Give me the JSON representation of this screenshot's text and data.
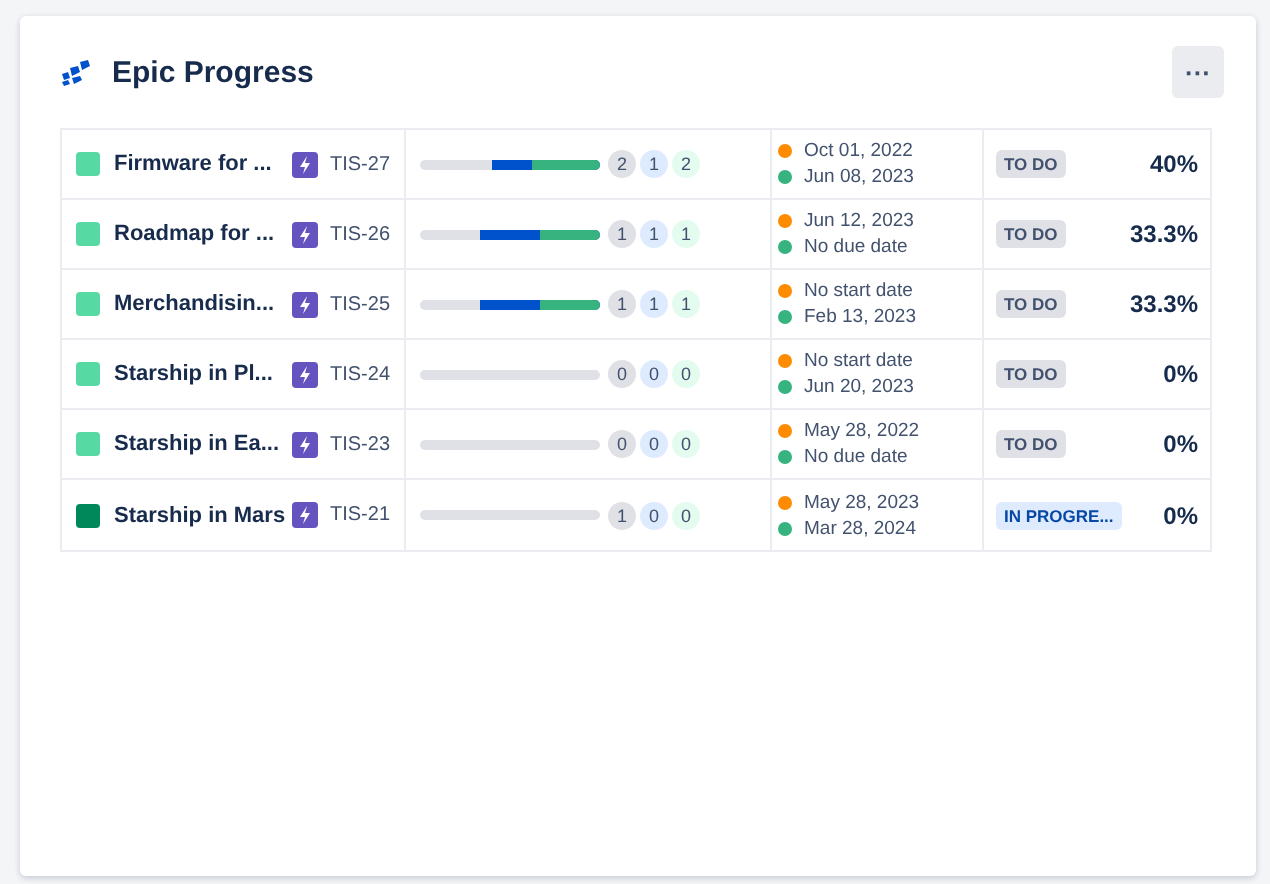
{
  "title": "Epic Progress",
  "menu_button": "···",
  "epics": [
    {
      "color": "#57d9a3",
      "name": "Firmware for ...",
      "key": "TIS-27",
      "started": {
        "level": 0.6
      },
      "done": {
        "level": 0.38
      },
      "counts": [
        "2",
        "1",
        "2"
      ],
      "start": "Oct 01, 2022",
      "due": "Jun 08, 2023",
      "status": {
        "kind": "todo",
        "label": "TO DO"
      },
      "percent": "40%"
    },
    {
      "color": "#57d9a3",
      "name": "Roadmap for ...",
      "key": "TIS-26",
      "started": {
        "level": 0.67
      },
      "done": {
        "level": 0.33
      },
      "counts": [
        "1",
        "1",
        "1"
      ],
      "start": "Jun 12, 2023",
      "due": "No due date",
      "status": {
        "kind": "todo",
        "label": "TO DO"
      },
      "percent": "33.3%"
    },
    {
      "color": "#57d9a3",
      "name": "Merchandisin...",
      "key": "TIS-25",
      "started": {
        "level": 0.67
      },
      "done": {
        "level": 0.33
      },
      "counts": [
        "1",
        "1",
        "1"
      ],
      "start": "No start date",
      "due": "Feb 13, 2023",
      "status": {
        "kind": "todo",
        "label": "TO DO"
      },
      "percent": "33.3%"
    },
    {
      "color": "#57d9a3",
      "name": "Starship in Pl...",
      "key": "TIS-24",
      "counts": [
        "0",
        "0",
        "0"
      ],
      "start": "No start date",
      "due": "Jun 20, 2023",
      "status": {
        "kind": "todo",
        "label": "TO DO"
      },
      "percent": "0%"
    },
    {
      "color": "#57d9a3",
      "name": "Starship in Ea...",
      "key": "TIS-23",
      "counts": [
        "0",
        "0",
        "0"
      ],
      "start": "May 28, 2022",
      "due": "No due date",
      "status": {
        "kind": "todo",
        "label": "TO DO"
      },
      "percent": "0%"
    },
    {
      "color": "#00875a",
      "name": "Starship in Mars",
      "key": "TIS-21",
      "counts": [
        "1",
        "0",
        "0"
      ],
      "start": "May 28, 2023",
      "due": "Mar 28, 2024",
      "status": {
        "kind": "inprogress",
        "label": "IN PROGRE..."
      },
      "percent": "0%"
    }
  ]
}
